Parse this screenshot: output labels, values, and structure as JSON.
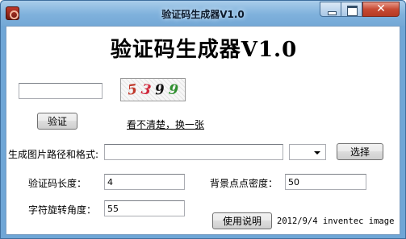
{
  "window": {
    "title": "验证码生成器V1.0",
    "close_glyph": "✕"
  },
  "header": {
    "title": "验证码生成器V1.0"
  },
  "verify": {
    "input_value": "",
    "captcha_chars": [
      "5",
      "3",
      "9",
      "9"
    ],
    "captcha_colors": [
      "#c0392b",
      "#d0283c",
      "#111111",
      "#2f8f2f"
    ],
    "button_label": "验证",
    "refresh_link": "看不清楚，换一张"
  },
  "output": {
    "path_label": "生成图片路径和格式:",
    "path_value": "",
    "format_value": "",
    "browse_label": "选择"
  },
  "settings": {
    "length_label": "验证码长度：",
    "length_value": "4",
    "density_label": "背景点点密度：",
    "density_value": "50",
    "rotation_label": "字符旋转角度：",
    "rotation_value": "55"
  },
  "footer": {
    "help_label": "使用说明",
    "credit": "2012/9/4 inventec image"
  }
}
